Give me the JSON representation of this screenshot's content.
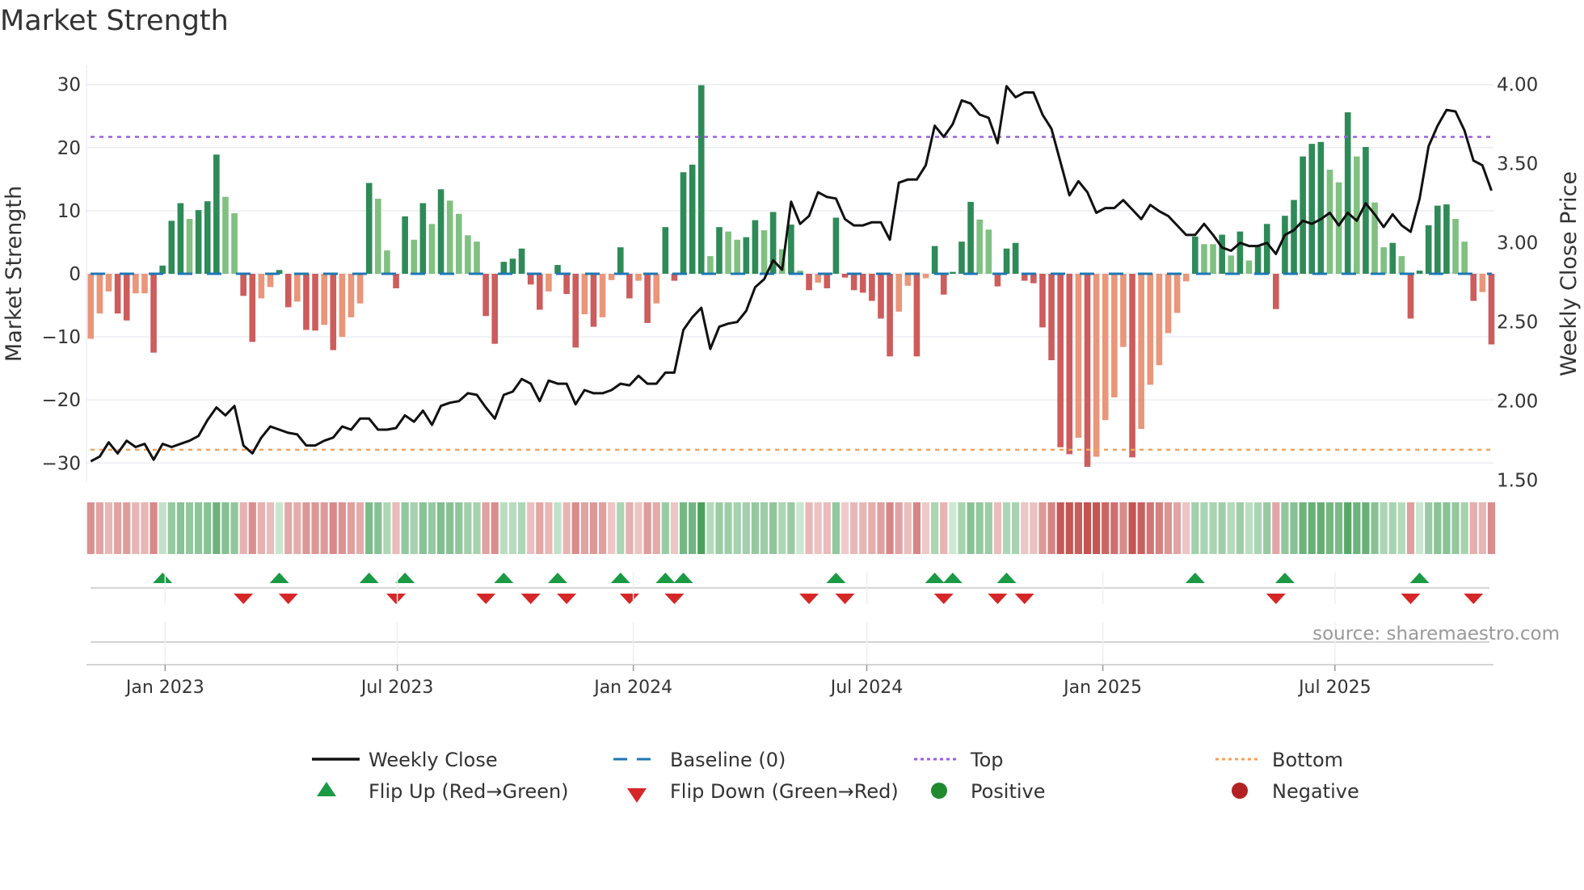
{
  "title": "Market Strength",
  "source": "source: sharemaestro.com",
  "chart_data": {
    "type": "bar",
    "title": "Market Strength",
    "ylabel": "Market Strength",
    "y2label": "Weekly Close Price",
    "ylim": [
      -30,
      30
    ],
    "y2lim": [
      1.5,
      4.0
    ],
    "yticks": [
      "−30",
      "−20",
      "−10",
      "0",
      "10",
      "20",
      "30"
    ],
    "ytick_values": [
      -30,
      -20,
      -10,
      0,
      10,
      20,
      30
    ],
    "y2ticks": [
      "1.50",
      "2.00",
      "2.50",
      "3.00",
      "3.50",
      "4.00"
    ],
    "y2tick_values": [
      1.5,
      2.0,
      2.5,
      3.0,
      3.5,
      4.0
    ],
    "first_week": "2022-11-04",
    "xticks": [
      {
        "label": "Jan 2023",
        "date": "2023-01-01"
      },
      {
        "label": "Jul 2023",
        "date": "2023-07-01"
      },
      {
        "label": "Jan 2024",
        "date": "2024-01-01"
      },
      {
        "label": "Jul 2024",
        "date": "2024-07-01"
      },
      {
        "label": "Jan 2025",
        "date": "2025-01-01"
      },
      {
        "label": "Jul 2025",
        "date": "2025-07-01"
      }
    ],
    "reference_lines": {
      "baseline": 0,
      "top": 21.7,
      "bottom": -27.9
    },
    "strength": [
      -10.3,
      -6.3,
      -2.8,
      -6.3,
      -7.4,
      -3.1,
      -3.1,
      -12.5,
      1.3,
      8.4,
      11.2,
      8.7,
      10.1,
      11.5,
      18.9,
      12.2,
      9.6,
      -3.5,
      -10.8,
      -3.9,
      -2.1,
      0.6,
      -5.3,
      -4.4,
      -8.9,
      -9.0,
      -8.1,
      -12.1,
      -10.0,
      -6.9,
      -4.7,
      14.4,
      11.9,
      3.7,
      -2.3,
      9.1,
      5.4,
      11.2,
      7.9,
      13.4,
      11.6,
      9.5,
      6.1,
      5.1,
      -6.7,
      -11.1,
      1.9,
      2.4,
      4.0,
      -1.7,
      -5.7,
      -2.8,
      1.4,
      -3.2,
      -11.7,
      -6.4,
      -8.4,
      -6.9,
      -1.0,
      4.2,
      -3.9,
      -1.1,
      -7.8,
      -4.7,
      7.4,
      -1.1,
      16.1,
      17.3,
      29.9,
      2.8,
      7.4,
      6.7,
      5.4,
      5.8,
      8.5,
      6.9,
      9.8,
      3.9,
      7.8,
      0.5,
      -2.6,
      -1.4,
      -2.3,
      8.9,
      -0.6,
      -2.6,
      -3.0,
      -4.3,
      -7.1,
      -13.1,
      -6.0,
      -1.9,
      -13.1,
      -0.7,
      4.4,
      -3.3,
      0.3,
      5.1,
      11.4,
      8.6,
      7.0,
      -2.0,
      4.0,
      4.9,
      -1.1,
      -1.5,
      -8.5,
      -13.7,
      -27.5,
      -28.6,
      -26.0,
      -30.6,
      -29.0,
      -23.2,
      -19.6,
      -11.6,
      -29.1,
      -24.6,
      -17.6,
      -14.5,
      -9.4,
      -6.2,
      -1.2,
      5.9,
      4.7,
      4.7,
      6.2,
      2.9,
      6.7,
      2.1,
      4.3,
      7.9,
      -5.6,
      9.2,
      11.7,
      18.6,
      20.6,
      20.9,
      16.5,
      14.5,
      25.6,
      18.6,
      20.1,
      11.3,
      4.2,
      4.9,
      2.8,
      -7.1,
      0.5,
      7.7,
      10.8,
      11.0,
      8.7,
      5.1,
      -4.3,
      -2.9,
      -11.2
    ],
    "weekly_close": [
      1.62,
      1.65,
      1.74,
      1.67,
      1.75,
      1.71,
      1.73,
      1.63,
      1.73,
      1.71,
      1.73,
      1.75,
      1.78,
      1.88,
      1.96,
      1.91,
      1.97,
      1.72,
      1.67,
      1.77,
      1.84,
      1.82,
      1.8,
      1.79,
      1.72,
      1.72,
      1.75,
      1.77,
      1.84,
      1.82,
      1.89,
      1.89,
      1.82,
      1.82,
      1.83,
      1.91,
      1.87,
      1.94,
      1.85,
      1.97,
      1.99,
      2.0,
      2.05,
      2.04,
      1.96,
      1.89,
      2.04,
      2.06,
      2.14,
      2.11,
      2.0,
      2.13,
      2.11,
      2.11,
      1.98,
      2.07,
      2.05,
      2.05,
      2.07,
      2.11,
      2.1,
      2.16,
      2.11,
      2.11,
      2.18,
      2.18,
      2.45,
      2.53,
      2.59,
      2.33,
      2.47,
      2.49,
      2.5,
      2.57,
      2.72,
      2.77,
      2.89,
      2.83,
      3.26,
      3.12,
      3.17,
      3.32,
      3.29,
      3.28,
      3.15,
      3.11,
      3.11,
      3.13,
      3.13,
      3.02,
      3.38,
      3.4,
      3.4,
      3.49,
      3.74,
      3.67,
      3.75,
      3.9,
      3.88,
      3.81,
      3.79,
      3.63,
      3.99,
      3.92,
      3.95,
      3.95,
      3.81,
      3.72,
      3.51,
      3.3,
      3.39,
      3.32,
      3.19,
      3.22,
      3.22,
      3.27,
      3.21,
      3.15,
      3.24,
      3.2,
      3.17,
      3.11,
      3.05,
      3.05,
      3.12,
      3.05,
      2.97,
      2.95,
      3.0,
      2.98,
      2.98,
      3.0,
      2.93,
      3.05,
      3.08,
      3.14,
      3.12,
      3.15,
      3.19,
      3.11,
      3.19,
      3.14,
      3.25,
      3.18,
      3.1,
      3.18,
      3.11,
      3.07,
      3.28,
      3.61,
      3.74,
      3.84,
      3.83,
      3.71,
      3.52,
      3.49,
      3.33
    ],
    "legend": {
      "weekly_close": "Weekly Close",
      "baseline": "Baseline (0)",
      "top": "Top",
      "bottom": "Bottom",
      "flip_up": "Flip Up (Red→Green)",
      "flip_down": "Flip Down (Green→Red)",
      "positive": "Positive",
      "negative": "Negative"
    },
    "legend_position": "bottom-center"
  },
  "colors": {
    "strong_up": "#2e8b57",
    "weak_up": "#80c080",
    "strong_down": "#cd5c5c",
    "weak_down": "#e9967a",
    "baseline": "#1f77b4",
    "top": "#9b5de5",
    "bottom": "#f4a259",
    "line": "#111111",
    "flip_up": "#1a9a44",
    "flip_down": "#d62728",
    "positive": "#1f8a2e",
    "negative": "#b22222"
  }
}
